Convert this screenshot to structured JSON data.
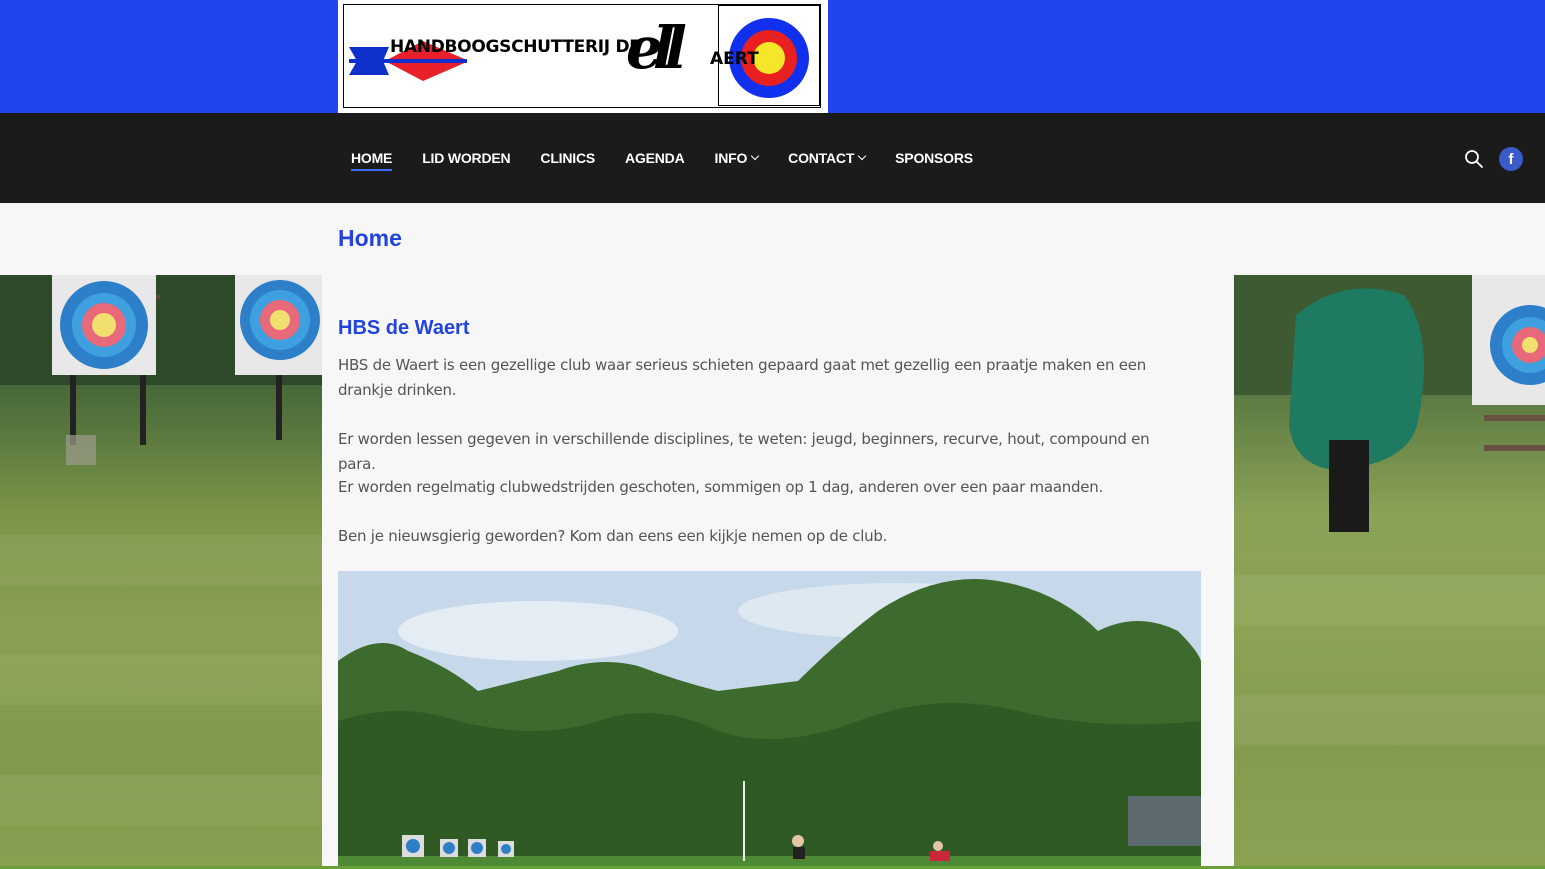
{
  "logo": {
    "text": "HANDBOOGSCHUTTERIJ DE",
    "script": "ell",
    "suffix": "AERT"
  },
  "nav": {
    "items": [
      {
        "label": "HOME",
        "active": true,
        "dropdown": false
      },
      {
        "label": "LID WORDEN",
        "active": false,
        "dropdown": false
      },
      {
        "label": "CLINICS",
        "active": false,
        "dropdown": false
      },
      {
        "label": "AGENDA",
        "active": false,
        "dropdown": false
      },
      {
        "label": "INFO",
        "active": false,
        "dropdown": true
      },
      {
        "label": "CONTACT",
        "active": false,
        "dropdown": true
      },
      {
        "label": "SPONSORS",
        "active": false,
        "dropdown": false
      }
    ],
    "search_icon": "search-icon",
    "social_icon": "facebook-icon",
    "social_glyph": "f"
  },
  "page": {
    "title": "Home"
  },
  "main": {
    "heading": "HBS de Waert",
    "paragraphs": [
      "HBS de Waert is een gezellige club waar serieus schieten gepaard gaat met gezellig een praatje maken en een drankje drinken.",
      "Er worden lessen gegeven in verschillende disciplines, te weten: jeugd, beginners, recurve, hout, compound en para.",
      "Er worden regelmatig clubwedstrijden geschoten, sommigen op 1 dag, anderen over een paar maanden.",
      "Ben je nieuwsgierig geworden? Kom dan eens een kijkje nemen op de club."
    ]
  },
  "colors": {
    "header_blue": "#2244ee",
    "nav_dark": "#1b1b1b",
    "accent": "#2244dd",
    "text": "#555555"
  }
}
